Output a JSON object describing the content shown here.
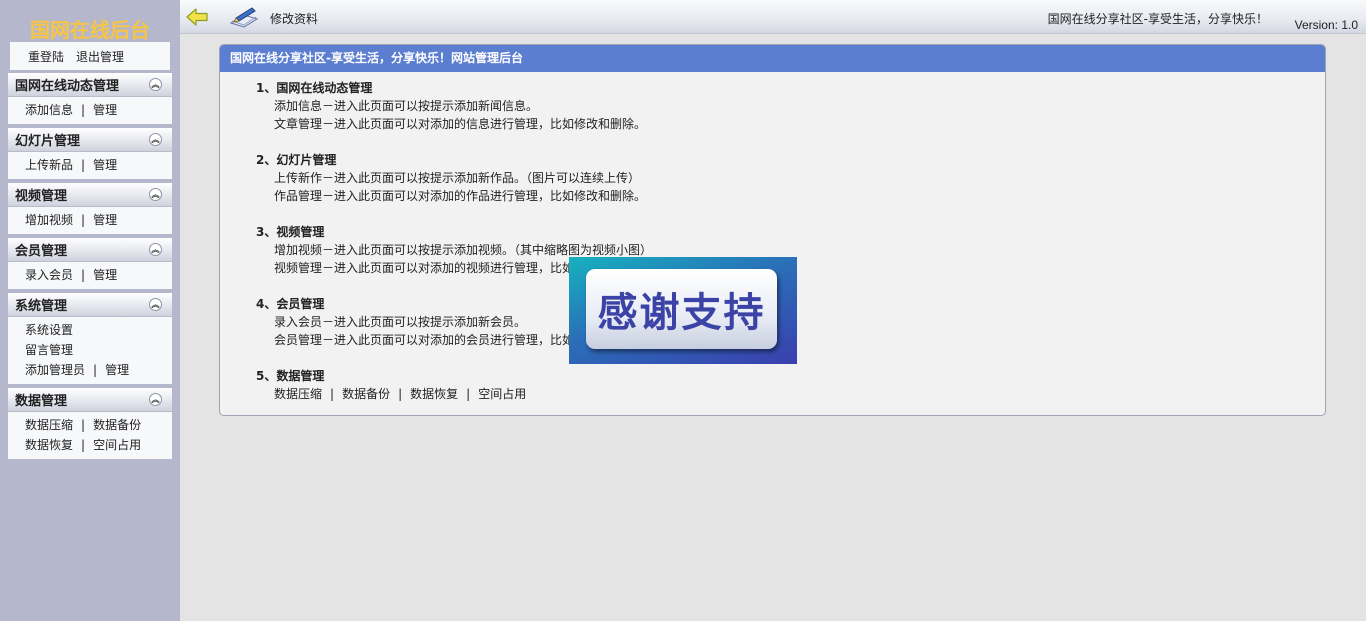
{
  "sidebar": {
    "site_title": "国网在线后台",
    "top_links": [
      "重登陆",
      "退出管理"
    ],
    "groups": [
      {
        "title": "国网在线动态管理",
        "rows": [
          [
            "添加信息",
            "管理"
          ]
        ]
      },
      {
        "title": "幻灯片管理",
        "rows": [
          [
            "上传新品",
            "管理"
          ]
        ]
      },
      {
        "title": "视频管理",
        "rows": [
          [
            "增加视频",
            "管理"
          ]
        ]
      },
      {
        "title": "会员管理",
        "rows": [
          [
            "录入会员",
            "管理"
          ]
        ]
      },
      {
        "title": "系统管理",
        "rows": [
          [
            "系统设置"
          ],
          [
            "留言管理"
          ],
          [
            "添加管理员",
            "管理"
          ]
        ]
      },
      {
        "title": "数据管理",
        "rows": [
          [
            "数据压缩",
            "数据备份"
          ],
          [
            "数据恢复",
            "空间占用"
          ]
        ]
      }
    ]
  },
  "topbar": {
    "page_name": "修改资料",
    "slogan": "国网在线分享社区-享受生活，分享快乐！",
    "version": "Version: 1.0"
  },
  "panel": {
    "header": "国网在线分享社区-享受生活，分享快乐！网站管理后台",
    "sections": [
      {
        "title": "1、国网在线动态管理",
        "lines": [
          "添加信息－进入此页面可以按提示添加新闻信息。",
          "文章管理－进入此页面可以对添加的信息进行管理，比如修改和删除。"
        ]
      },
      {
        "title": "2、幻灯片管理",
        "lines": [
          "上传新作－进入此页面可以按提示添加新作品。（图片可以连续上传）",
          "作品管理－进入此页面可以对添加的作品进行管理，比如修改和删除。"
        ]
      },
      {
        "title": "3、视频管理",
        "lines": [
          "增加视频－进入此页面可以按提示添加视频。（其中缩略图为视频小图）",
          "视频管理－进入此页面可以对添加的视频进行管理，比如修改和删除。"
        ]
      },
      {
        "title": "4、会员管理",
        "lines": [
          "录入会员－进入此页面可以按提示添加新会员。",
          "会员管理－进入此页面可以对添加的会员进行管理，比如修改和删除。"
        ]
      }
    ],
    "data_section": {
      "title": "5、数据管理",
      "links": [
        "数据压缩",
        "数据备份",
        "数据恢复",
        "空间占用"
      ]
    }
  },
  "overlay": {
    "text": "感谢支持"
  },
  "colors": {
    "sidebar_bg": "#b5b8cc",
    "site_title": "#f6c447",
    "panel_header": "#5b7ed0",
    "badge_text": "#3c43a6"
  },
  "icons": {
    "back": "back-arrow-icon",
    "edit": "edit-pencil-icon",
    "collapse": "collapse-up-icon"
  }
}
